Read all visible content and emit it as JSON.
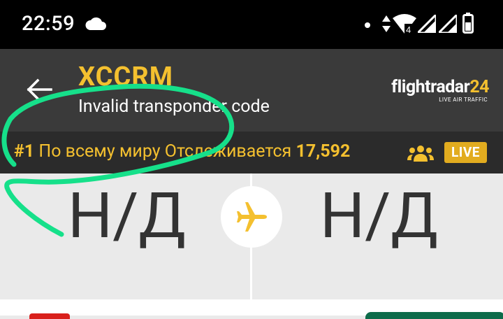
{
  "status_bar": {
    "time": "22:59",
    "network_badge": "4"
  },
  "toolbar": {
    "callsign": "XCCRM",
    "subtitle": "Invalid transponder code",
    "logo_word": "flightradar",
    "logo_number": "24",
    "logo_tagline": "LIVE AIR TRAFFIC"
  },
  "rank_bar": {
    "rank": "#1",
    "rank_scope": "По всему миру",
    "tracked_label": "Отслеживается",
    "tracked_count": "17,592",
    "live_label": "LIVE"
  },
  "route": {
    "origin": "Н/Д",
    "destination": "Н/Д"
  },
  "colors": {
    "accent_yellow": "#f4c02f",
    "toolbar_bg": "#3a3a3a",
    "annotation_green": "#16e08a"
  },
  "icons": [
    "cloud-icon",
    "wifi-icon",
    "signal-icon",
    "battery-icon",
    "back-arrow-icon",
    "people-icon",
    "airplane-icon"
  ]
}
